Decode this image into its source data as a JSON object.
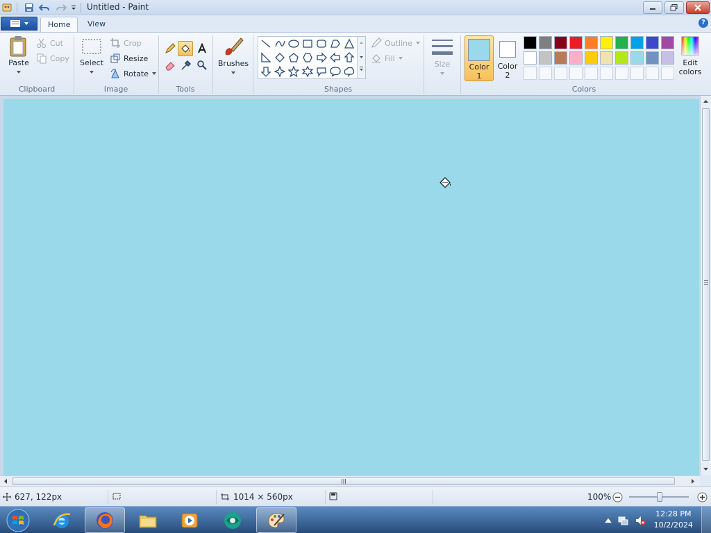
{
  "window": {
    "title": "Untitled - Paint"
  },
  "tabs": {
    "home": "Home",
    "view": "View"
  },
  "ribbon": {
    "clipboard": {
      "paste": "Paste",
      "cut": "Cut",
      "copy": "Copy",
      "group": "Clipboard"
    },
    "image": {
      "select": "Select",
      "crop": "Crop",
      "resize": "Resize",
      "rotate": "Rotate",
      "group": "Image"
    },
    "tools": {
      "group": "Tools"
    },
    "brushes": {
      "label": "Brushes"
    },
    "shapes": {
      "outline": "Outline",
      "fill": "Fill",
      "group": "Shapes"
    },
    "size": {
      "label": "Size"
    },
    "colors": {
      "color1_line1": "Color",
      "color1_line2": "1",
      "color2_line1": "Color",
      "color2_line2": "2",
      "edit_line1": "Edit",
      "edit_line2": "colors",
      "group": "Colors",
      "color1_value": "#99d9ea",
      "color2_value": "#ffffff",
      "palette_row1": [
        "#000000",
        "#7f7f7f",
        "#880015",
        "#ed1c24",
        "#ff7f27",
        "#fff200",
        "#22b14c",
        "#00a2e8",
        "#3f48cc",
        "#a349a4"
      ],
      "palette_row2": [
        "#ffffff",
        "#c3c3c3",
        "#b97a57",
        "#ffaec9",
        "#ffc90e",
        "#efe4b0",
        "#b5e61d",
        "#99d9ea",
        "#7092be",
        "#c8bfe7"
      ]
    }
  },
  "canvas": {
    "background": "#99d9ea"
  },
  "status": {
    "cursor_position": "627, 122px",
    "canvas_size": "1014 × 560px",
    "zoom": "100%"
  },
  "taskbar": {
    "time": "12:28 PM",
    "date": "10/2/2024"
  }
}
